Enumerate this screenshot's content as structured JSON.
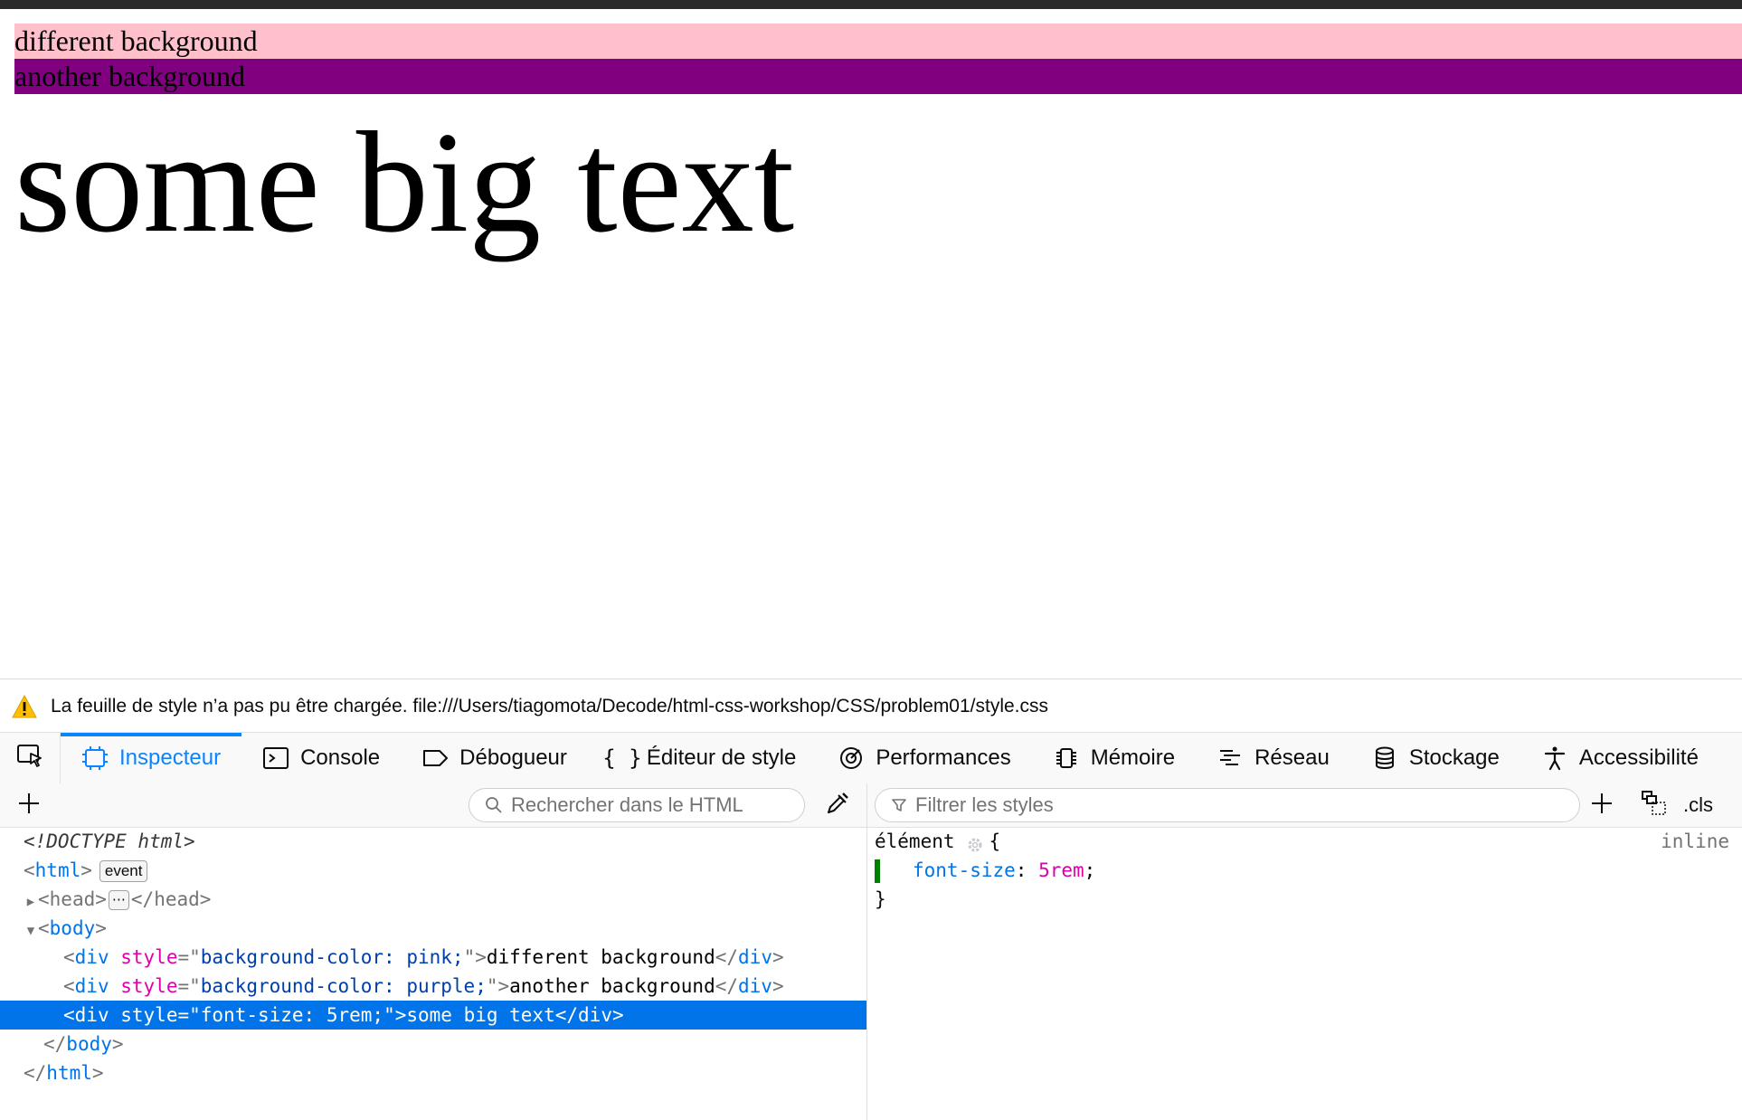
{
  "page": {
    "pink_text": "different background",
    "purple_text": "another background",
    "big_text": "some big text"
  },
  "warning": {
    "icon": "warning-icon",
    "message": "La feuille de style n’a pas pu être chargée. file:///Users/tiagomota/Decode/html-css-workshop/CSS/problem01/style.css"
  },
  "tabs": [
    {
      "label": "Inspecteur",
      "icon": "inspector-icon",
      "selected": true
    },
    {
      "label": "Console",
      "icon": "console-icon"
    },
    {
      "label": "Débogueur",
      "icon": "debugger-icon"
    },
    {
      "label": "Éditeur de style",
      "icon": "style-editor-icon"
    },
    {
      "label": "Performances",
      "icon": "performance-icon"
    },
    {
      "label": "Mémoire",
      "icon": "memory-icon"
    },
    {
      "label": "Réseau",
      "icon": "network-icon"
    },
    {
      "label": "Stockage",
      "icon": "storage-icon"
    },
    {
      "label": "Accessibilité",
      "icon": "accessibility-icon"
    }
  ],
  "markup": {
    "search_placeholder": "Rechercher dans le HTML",
    "doctype": "<!DOCTYPE html>",
    "html_open": "html",
    "event_badge": "event",
    "head_open": "head",
    "head_close": "head",
    "dots_badge": "⋯",
    "body_open": "body",
    "div1_attr": "style",
    "div1_val": "background-color: pink;",
    "div1_text": "different background",
    "div2_attr": "style",
    "div2_val": "background-color: purple;",
    "div2_text": "another background",
    "div3_attr": "style",
    "div3_val": "font-size: 5rem;",
    "div3_text": "some big text",
    "div_tag": "div",
    "body_close": "body",
    "html_close": "html"
  },
  "rules": {
    "filter_placeholder": "Filtrer les styles",
    "cls_label": ".cls",
    "selector": "élément",
    "source": "inline",
    "property": "font-size",
    "value": "5rem"
  },
  "colors": {
    "pink": "#ffc0cb",
    "purple": "#800080",
    "accent": "#0a84ff",
    "selected_row": "#0074e8"
  }
}
